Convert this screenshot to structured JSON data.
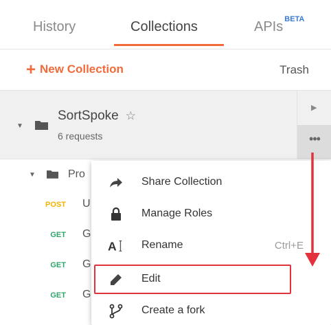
{
  "tabs": [
    {
      "label": "History"
    },
    {
      "label": "Collections",
      "active": true
    },
    {
      "label": "APIs",
      "badge": "BETA"
    }
  ],
  "toolbar": {
    "new_collection_label": "New Collection",
    "trash_label": "Trash"
  },
  "collection": {
    "name": "SortSpoke",
    "request_count": "6 requests"
  },
  "tree": {
    "folder_name": "Pro",
    "requests": [
      {
        "method": "POST",
        "name": "U"
      },
      {
        "method": "GET",
        "name": "G"
      },
      {
        "method": "GET",
        "name": "G"
      },
      {
        "method": "GET",
        "name": "G"
      }
    ]
  },
  "context_menu": {
    "items": [
      {
        "label": "Share Collection",
        "icon": "share-arrow-icon"
      },
      {
        "label": "Manage Roles",
        "icon": "lock-icon"
      },
      {
        "label": "Rename",
        "icon": "rename-icon",
        "shortcut": "Ctrl+E"
      },
      {
        "label": "Edit",
        "icon": "pencil-icon",
        "highlighted": true
      },
      {
        "label": "Create a fork",
        "icon": "fork-icon"
      }
    ]
  },
  "colors": {
    "accent": "#f26b3a",
    "beta": "#3a7bd5",
    "post": "#f5b400",
    "get": "#2ea36a",
    "annotation": "#e2333c"
  }
}
